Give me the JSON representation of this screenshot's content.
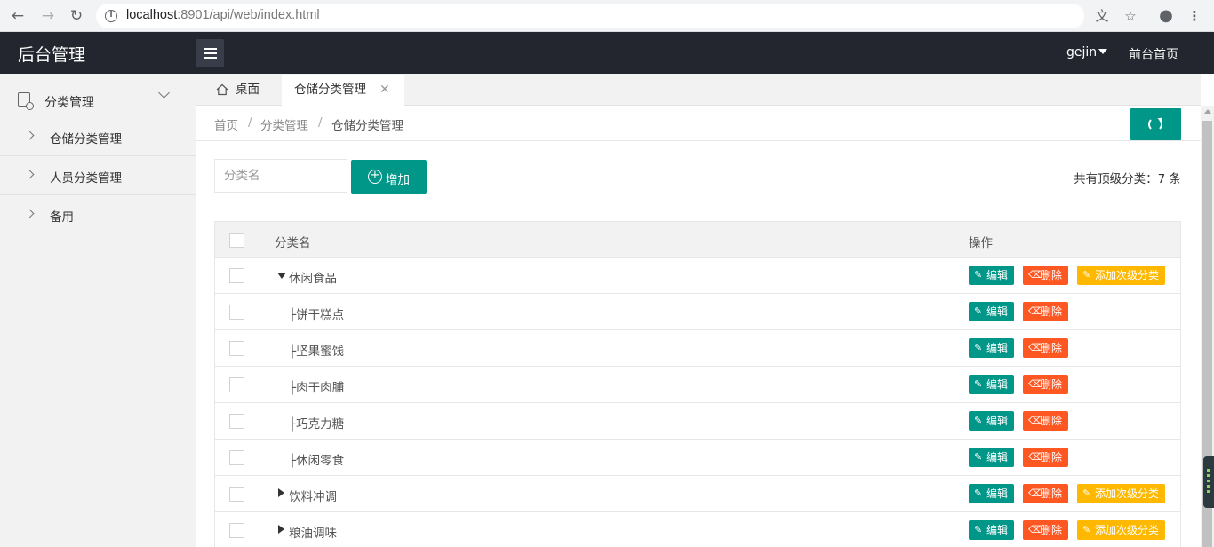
{
  "browser": {
    "url_host": "localhost",
    "url_rest": ":8901/api/web/index.html"
  },
  "header": {
    "title": "后台管理",
    "user": "gejin",
    "front_link": "前台首页"
  },
  "sidebar": {
    "group_label": "分类管理",
    "items": [
      {
        "label": "仓储分类管理"
      },
      {
        "label": "人员分类管理"
      },
      {
        "label": "备用"
      }
    ]
  },
  "tabs": [
    {
      "label": "桌面"
    },
    {
      "label": "仓储分类管理"
    }
  ],
  "breadcrumb": [
    "首页",
    "分类管理",
    "仓储分类管理"
  ],
  "breadcrumb_sep": "/",
  "toolbar": {
    "search_placeholder": "分类名",
    "add_label": "增加",
    "count_text": "共有顶级分类：7 条"
  },
  "table": {
    "headers": {
      "name": "分类名",
      "ops": "操作"
    },
    "buttons": {
      "edit": "编辑",
      "delete": "删除",
      "add_sub": "添加次级分类"
    },
    "rows": [
      {
        "name": "休闲食品",
        "level": "parent-expanded"
      },
      {
        "name": "├饼干糕点",
        "level": "child"
      },
      {
        "name": "├坚果蜜饯",
        "level": "child"
      },
      {
        "name": "├肉干肉脯",
        "level": "child"
      },
      {
        "name": "├巧克力糖",
        "level": "child"
      },
      {
        "name": "├休闲零食",
        "level": "child"
      },
      {
        "name": "饮料冲调",
        "level": "parent-collapsed"
      },
      {
        "name": "粮油调味",
        "level": "parent-collapsed"
      }
    ]
  },
  "colors": {
    "header_bg": "#23262e",
    "primary": "#009688",
    "danger": "#ff5722",
    "warn": "#ffb800"
  }
}
